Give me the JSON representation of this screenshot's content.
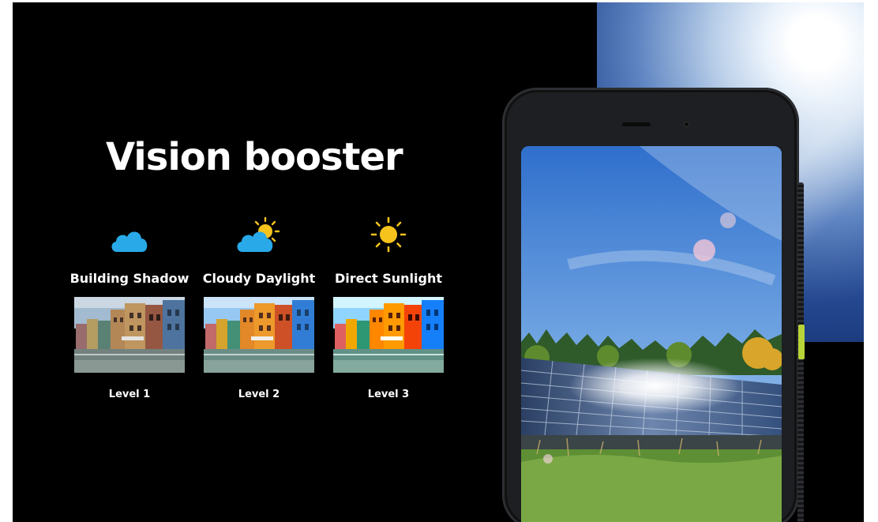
{
  "title": "Vision booster",
  "modes": [
    {
      "label": "Building Shadow",
      "level": "Level 1",
      "icon": "cloud-icon"
    },
    {
      "label": "Cloudy Daylight",
      "level": "Level 2",
      "icon": "sun-behind-cloud-icon"
    },
    {
      "label": "Direct Sunlight",
      "level": "Level 3",
      "icon": "sun-icon"
    }
  ],
  "colors": {
    "background": "#000000",
    "text": "#ffffff",
    "icon_cloud": "#29a9e8",
    "icon_sun": "#f6c21c",
    "side_key": "#b7d43a"
  }
}
